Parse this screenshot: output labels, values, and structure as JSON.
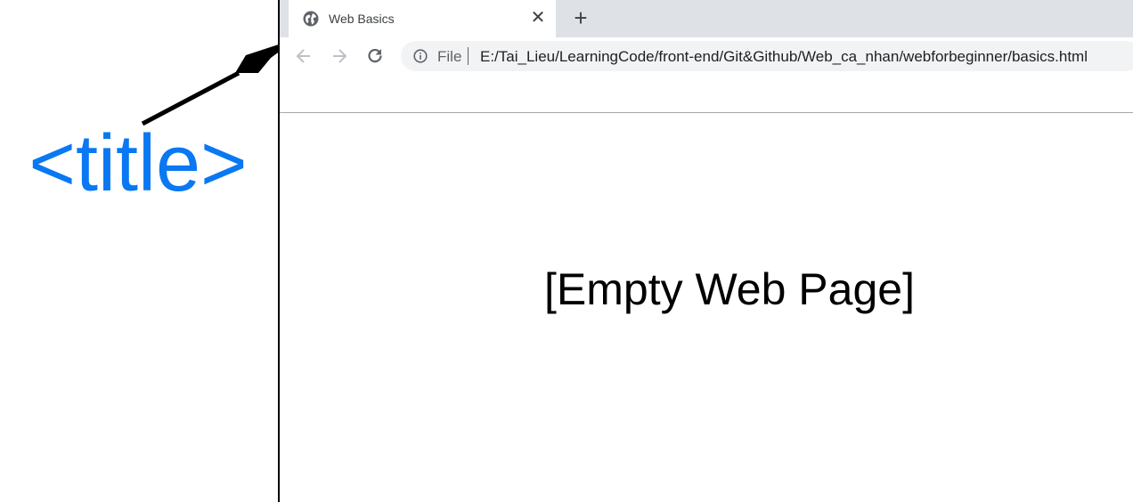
{
  "annotation": {
    "label": "<title>",
    "color": "#0a78f2"
  },
  "browser": {
    "tab": {
      "title": "Web Basics",
      "icon": "globe-icon",
      "close_glyph": "✕"
    },
    "new_tab_glyph": "+",
    "toolbar": {
      "back_icon": "arrow-left-icon",
      "forward_icon": "arrow-right-icon",
      "reload_icon": "reload-icon"
    },
    "omnibox": {
      "info_icon": "info-icon",
      "scheme_label": "File",
      "url": "E:/Tai_Lieu/LearningCode/front-end/Git&Github/Web_ca_nhan/webforbeginner/basics.html"
    },
    "content": {
      "placeholder": "[Empty Web Page]"
    }
  },
  "colors": {
    "tabstrip_bg": "#dee1e6",
    "omnibox_bg": "#f1f3f4",
    "accent_blue": "#0a78f2"
  }
}
